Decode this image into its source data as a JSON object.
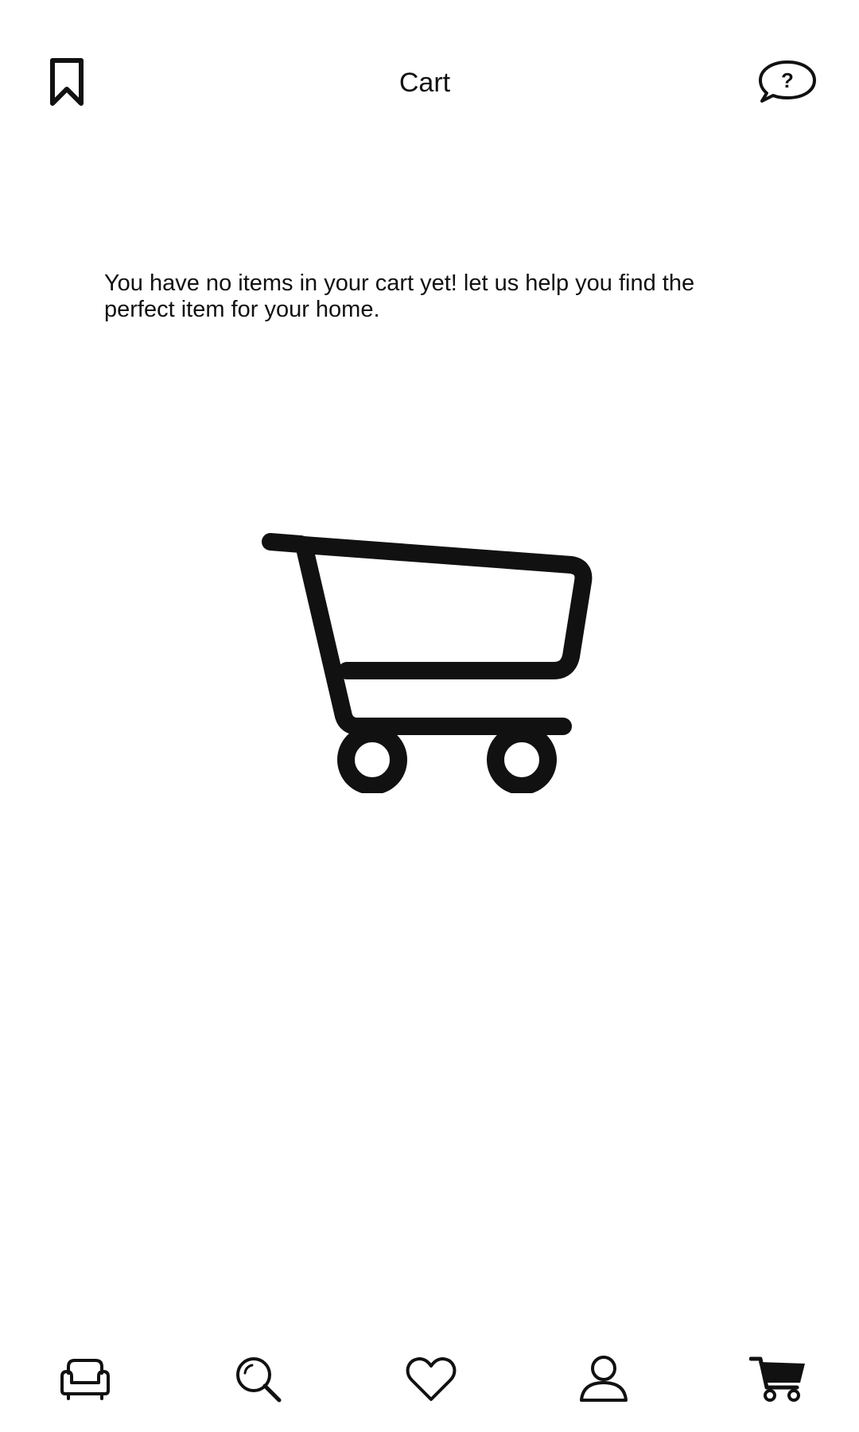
{
  "header": {
    "title": "Cart",
    "left_icon": "bookmark-icon",
    "right_icon": "help-chat-icon"
  },
  "main": {
    "empty_message": "You have no items in your cart yet! let us help you find the perfect item for your home.",
    "illustration_icon": "shopping-cart-icon"
  },
  "bottom_nav": {
    "items": [
      {
        "icon": "sofa-icon",
        "active": false
      },
      {
        "icon": "search-icon",
        "active": false
      },
      {
        "icon": "heart-icon",
        "active": false
      },
      {
        "icon": "user-icon",
        "active": false
      },
      {
        "icon": "cart-icon",
        "active": true
      }
    ]
  },
  "colors": {
    "background": "#ffffff",
    "foreground": "#111111"
  }
}
